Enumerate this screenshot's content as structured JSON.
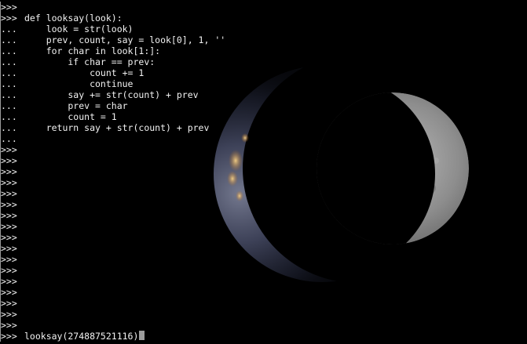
{
  "terminal": {
    "lines": [
      {
        "prompt": ">>>",
        "code": ""
      },
      {
        "prompt": ">>>",
        "code": "def looksay(look):"
      },
      {
        "prompt": "...",
        "code": "    look = str(look)"
      },
      {
        "prompt": "...",
        "code": "    prev, count, say = look[0], 1, ''"
      },
      {
        "prompt": "...",
        "code": "    for char in look[1:]:"
      },
      {
        "prompt": "...",
        "code": "        if char == prev:"
      },
      {
        "prompt": "...",
        "code": "            count += 1"
      },
      {
        "prompt": "...",
        "code": "            continue"
      },
      {
        "prompt": "...",
        "code": "        say += str(count) + prev"
      },
      {
        "prompt": "...",
        "code": "        prev = char"
      },
      {
        "prompt": "...",
        "code": "        count = 1"
      },
      {
        "prompt": "...",
        "code": "    return say + str(count) + prev"
      },
      {
        "prompt": "...",
        "code": ""
      },
      {
        "prompt": ">>>",
        "code": ""
      },
      {
        "prompt": ">>>",
        "code": ""
      },
      {
        "prompt": ">>>",
        "code": ""
      },
      {
        "prompt": ">>>",
        "code": ""
      },
      {
        "prompt": ">>>",
        "code": ""
      },
      {
        "prompt": ">>>",
        "code": ""
      },
      {
        "prompt": ">>>",
        "code": ""
      },
      {
        "prompt": ">>>",
        "code": ""
      },
      {
        "prompt": ">>>",
        "code": ""
      },
      {
        "prompt": ">>>",
        "code": ""
      },
      {
        "prompt": ">>>",
        "code": ""
      },
      {
        "prompt": ">>>",
        "code": ""
      },
      {
        "prompt": ">>>",
        "code": ""
      },
      {
        "prompt": ">>>",
        "code": ""
      },
      {
        "prompt": ">>>",
        "code": ""
      },
      {
        "prompt": ">>>",
        "code": ""
      },
      {
        "prompt": ">>>",
        "code": ""
      },
      {
        "prompt": ">>>",
        "code": "looksay(274887521116)"
      }
    ]
  },
  "wallpaper": {
    "icon": "moon-eclipse-wallpaper",
    "background_color": "#000000"
  },
  "colors": {
    "text": "#f2f2f2",
    "cursor": "#9c9c9c"
  }
}
